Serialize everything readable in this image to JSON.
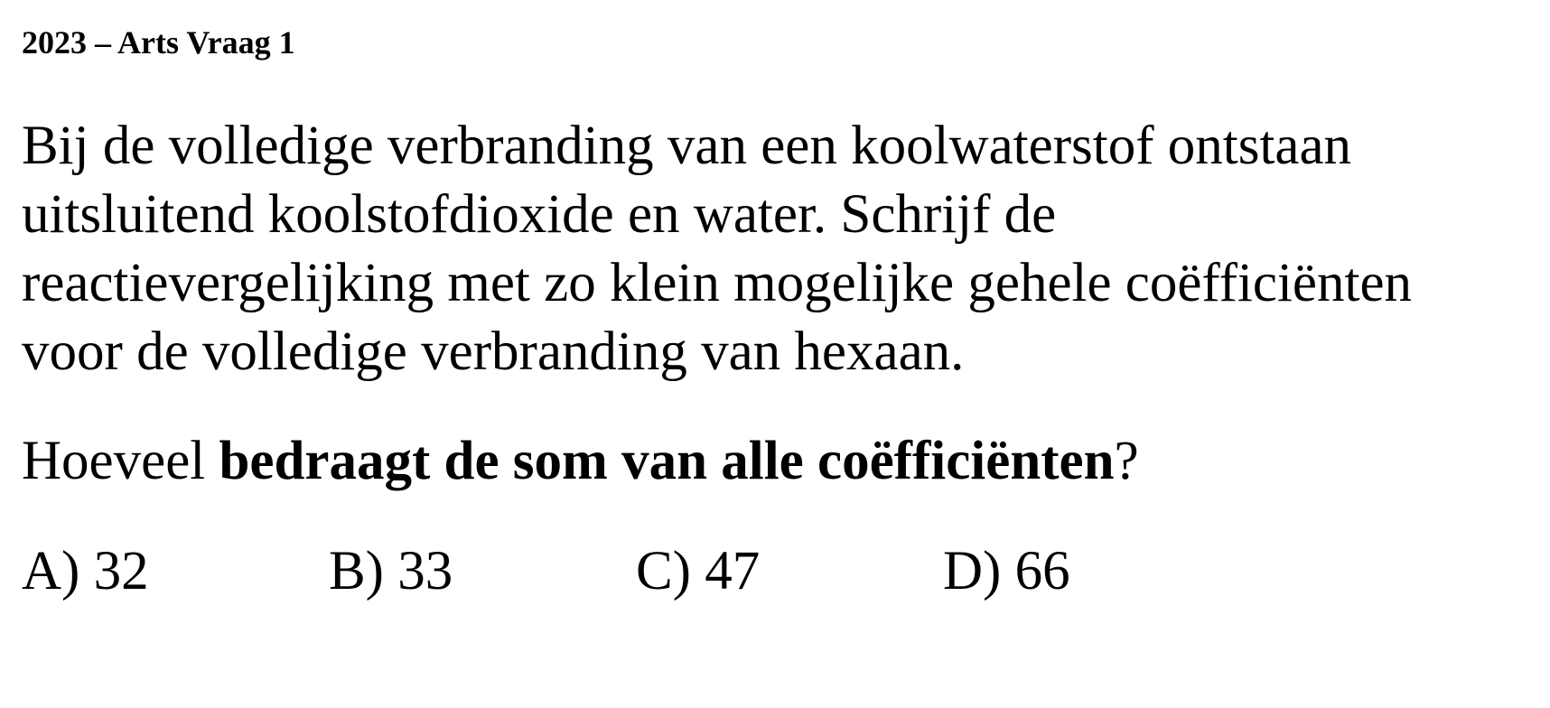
{
  "title": "2023 – Arts Vraag 1",
  "paragraph_lines": [
    "Bij de volledige verbranding van een koolwaterstof ontstaan",
    "uitsluitend koolstofdioxide en water. Schrijf de",
    "reactievergelijking met zo klein mogelijke gehele coëfficiënten",
    "voor de volledige verbranding van hexaan."
  ],
  "question": {
    "prefix": "Hoeveel ",
    "bold": "bedraagt de som van alle coëfficiënten",
    "suffix": "?"
  },
  "options": [
    "A) 32",
    "B) 33",
    "C) 47",
    "D) 66"
  ]
}
